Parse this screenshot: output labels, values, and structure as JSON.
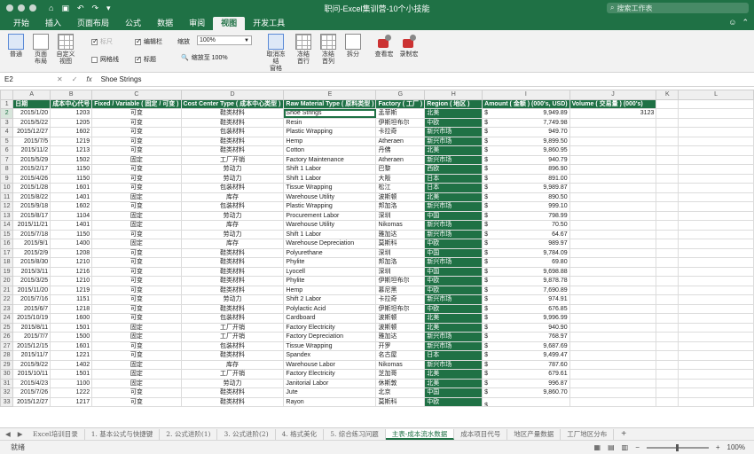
{
  "window": {
    "title": "职问-Excel集训营-10个小技能",
    "search_placeholder": "搜索工作表"
  },
  "ribbon_tabs": [
    "开始",
    "插入",
    "页面布局",
    "公式",
    "数据",
    "审阅",
    "视图",
    "开发工具"
  ],
  "active_tab": "视图",
  "ribbon": {
    "normal": "普通",
    "page_layout": "页面\n布局",
    "custom_view": "自定义\n视图",
    "ruler": "标尺",
    "formula_bar": "编辑栏",
    "gridlines": "网格线",
    "headings": "标题",
    "zoom_label": "缩放",
    "zoom_value": "100%",
    "zoom_100": "缩放至 100%",
    "unfreeze": "取消冻结\n窗格",
    "freeze_top_row": "冻结\n首行",
    "freeze_first_col": "冻结\n首列",
    "split": "拆分",
    "view_macros": "查看宏",
    "record_macro": "录制宏"
  },
  "formula_bar": {
    "name_box": "E2",
    "fx": "fx",
    "value": "Shoe Strings"
  },
  "columns": [
    "A",
    "B",
    "C",
    "D",
    "E",
    "G",
    "H",
    "I",
    "J",
    "K",
    "L"
  ],
  "header_row": [
    "日期",
    "成本中心代号",
    "Fixed / Variable ( 固定 / 可变 )",
    "Cost Center Type ( 成本中心类型 )",
    "Raw Material Type ( 原料类型 )",
    "Factory ( 工厂 )",
    "Region ( 地区 )",
    "Amount ( 金额 ) (000's, USD)",
    "Volume ( 交易量 ) (000's)",
    "",
    ""
  ],
  "rows": [
    [
      "2015/1/20",
      "1203",
      "可变",
      "鞋类材料",
      "Shoe Strings",
      "孟菲斯",
      "北美",
      "9,949.89",
      "3123"
    ],
    [
      "2015/5/22",
      "1205",
      "可变",
      "鞋类材料",
      "Resin",
      "伊斯坦布尔",
      "中欧",
      "7,749.98",
      ""
    ],
    [
      "2015/12/27",
      "1602",
      "可变",
      "包装材料",
      "Plastic Wrapping",
      "卡拉奇",
      "新兴市场",
      "949.70",
      ""
    ],
    [
      "2015/7/5",
      "1219",
      "可变",
      "鞋类材料",
      "Hemp",
      "Atheraen",
      "新兴市场",
      "9,899.50",
      ""
    ],
    [
      "2015/11/2",
      "1213",
      "可变",
      "鞋类材料",
      "Cotton",
      "丹佛",
      "北美",
      "9,860.95",
      ""
    ],
    [
      "2015/5/29",
      "1502",
      "固定",
      "工厂开销",
      "Factory Maintenance",
      "Atheraen",
      "新兴市场",
      "940.79",
      ""
    ],
    [
      "2015/2/17",
      "1150",
      "可变",
      "劳动力",
      "Shift 1 Labor",
      "巴黎",
      "西欧",
      "896.90",
      ""
    ],
    [
      "2015/4/26",
      "1150",
      "可变",
      "劳动力",
      "Shift 1 Labor",
      "大阪",
      "日本",
      "891.00",
      ""
    ],
    [
      "2015/1/28",
      "1601",
      "可变",
      "包装材料",
      "Tissue Wrapping",
      "松江",
      "日本",
      "9,989.87",
      ""
    ],
    [
      "2015/8/22",
      "1401",
      "固定",
      "库存",
      "Warehouse Utility",
      "波斯顿",
      "北美",
      "890.50",
      ""
    ],
    [
      "2015/9/18",
      "1602",
      "可变",
      "包装材料",
      "Plastic Wrapping",
      "邦加洛",
      "新兴市场",
      "999.10",
      ""
    ],
    [
      "2015/8/17",
      "1104",
      "固定",
      "劳动力",
      "Procurement Labor",
      "深圳",
      "中国",
      "798.99",
      ""
    ],
    [
      "2015/11/21",
      "1401",
      "固定",
      "库存",
      "Warehouse Utility",
      "Nikomas",
      "新兴市场",
      "70.50",
      ""
    ],
    [
      "2015/7/18",
      "1150",
      "可变",
      "劳动力",
      "Shift 1 Labor",
      "雅加达",
      "新兴市场",
      "64.67",
      ""
    ],
    [
      "2015/9/1",
      "1400",
      "固定",
      "库存",
      "Warehouse Depreciation",
      "莫斯科",
      "中欧",
      "989.97",
      ""
    ],
    [
      "2015/2/9",
      "1208",
      "可变",
      "鞋类材料",
      "Polyurethane",
      "深圳",
      "中国",
      "9,784.09",
      ""
    ],
    [
      "2015/8/30",
      "1210",
      "可变",
      "鞋类材料",
      "Phylite",
      "邦加洛",
      "新兴市场",
      "69.80",
      ""
    ],
    [
      "2015/3/11",
      "1216",
      "可变",
      "鞋类材料",
      "Lyocell",
      "深圳",
      "中国",
      "9,698.88",
      ""
    ],
    [
      "2015/3/25",
      "1210",
      "可变",
      "鞋类材料",
      "Phylite",
      "伊斯坦布尔",
      "中欧",
      "9,878.78",
      ""
    ],
    [
      "2015/11/20",
      "1219",
      "可变",
      "鞋类材料",
      "Hemp",
      "慕尼黑",
      "中欧",
      "7,690.89",
      ""
    ],
    [
      "2015/7/16",
      "1151",
      "可变",
      "劳动力",
      "Shift 2 Labor",
      "卡拉奇",
      "新兴市场",
      "974.91",
      ""
    ],
    [
      "2015/6/7",
      "1218",
      "可变",
      "鞋类材料",
      "Polylactic Acid",
      "伊斯坦布尔",
      "中欧",
      "676.85",
      ""
    ],
    [
      "2015/10/19",
      "1600",
      "可变",
      "包装材料",
      "Cardboard",
      "波斯顿",
      "北美",
      "9,996.99",
      ""
    ],
    [
      "2015/8/11",
      "1501",
      "固定",
      "工厂开销",
      "Factory Electricity",
      "波斯顿",
      "北美",
      "940.90",
      ""
    ],
    [
      "2015/7/7",
      "1500",
      "固定",
      "工厂开销",
      "Factory Depreciation",
      "雅加达",
      "新兴市场",
      "768.97",
      ""
    ],
    [
      "2015/12/15",
      "1601",
      "可变",
      "包装材料",
      "Tissue Wrapping",
      "开罗",
      "新兴市场",
      "9,687.69",
      ""
    ],
    [
      "2015/11/7",
      "1221",
      "可变",
      "鞋类材料",
      "Spandex",
      "名古屋",
      "日本",
      "9,499.47",
      ""
    ],
    [
      "2015/9/22",
      "1402",
      "固定",
      "库存",
      "Warehouse Labor",
      "Nikomas",
      "新兴市场",
      "787.60",
      ""
    ],
    [
      "2015/10/11",
      "1501",
      "固定",
      "工厂开销",
      "Factory Electricity",
      "芝加哥",
      "北美",
      "679.61",
      ""
    ],
    [
      "2015/4/23",
      "1100",
      "固定",
      "劳动力",
      "Janitorial Labor",
      "休斯敦",
      "北美",
      "996.87",
      ""
    ],
    [
      "2015/7/26",
      "1222",
      "可变",
      "鞋类材料",
      "Jute",
      "北京",
      "中国",
      "9,860.70",
      ""
    ],
    [
      "2015/12/27",
      "1217",
      "可变",
      "鞋类材料",
      "Rayon",
      "莫斯科",
      "中欧",
      "",
      ""
    ]
  ],
  "sheet_tabs": [
    "Excel培训目录",
    "1. 基本公式与快捷键",
    "2. 公式进阶(1)",
    "3. 公式进阶(2)",
    "4. 格式美化",
    "5. 综合练习问题",
    "主表-成本流水数据",
    "成本项目代号",
    "地区产量数据",
    "工厂地区分布"
  ],
  "active_sheet": "主表-成本流水数据",
  "status": {
    "ready": "就绪",
    "zoom": "100%"
  },
  "colors": {
    "excel_green": "#1f7145"
  }
}
